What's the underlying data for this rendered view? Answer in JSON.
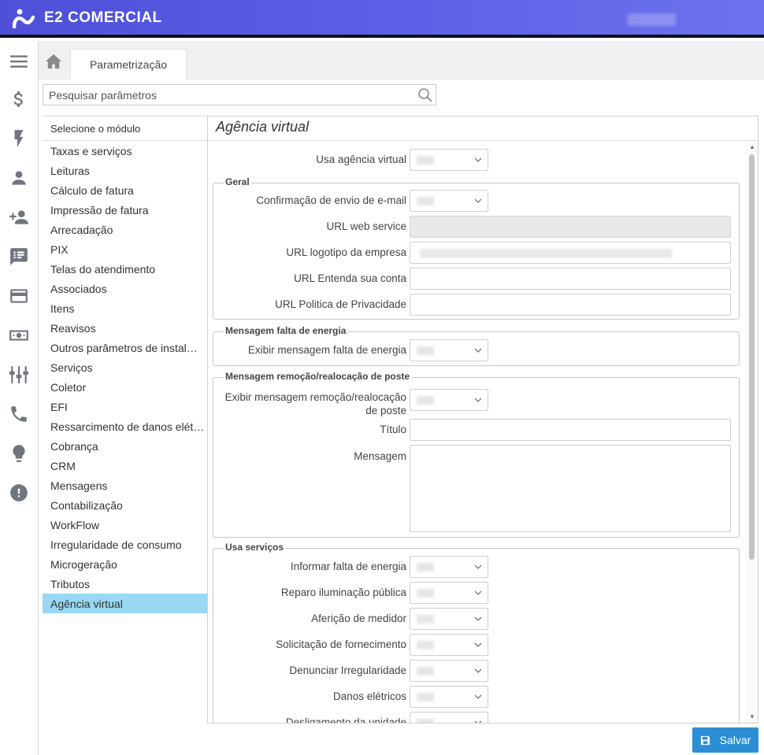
{
  "app": {
    "title": "E2 COMERCIAL"
  },
  "tabs": {
    "active": "Parametrização"
  },
  "search": {
    "placeholder": "Pesquisar parâmetros"
  },
  "modules": {
    "header": "Selecione o módulo",
    "items": [
      "Taxas e serviços",
      "Leituras",
      "Cálculo de fatura",
      "Impressão de fatura",
      "Arrecadação",
      "PIX",
      "Telas do atendimento",
      "Associados",
      "Itens",
      "Reavisos",
      "Outros parâmetros de instal…",
      "Serviços",
      "Coletor",
      "EFI",
      "Ressarcimento de danos elét…",
      "Cobrança",
      "CRM",
      "Mensagens",
      "Contabilização",
      "WorkFlow",
      "Irregularidade de consumo",
      "Microgeração",
      "Tributos",
      "Agência virtual"
    ],
    "active": "Agência virtual"
  },
  "panel": {
    "title": "Agência virtual",
    "usa_agencia": "Usa agência virtual",
    "geral": {
      "legend": "Geral",
      "confirmacao": "Confirmação de envio de e-mail",
      "url_ws": "URL web service",
      "url_logo": "URL logotipo da empresa",
      "url_entenda": "URL Entenda sua conta",
      "url_privacidade": "URL Politica de Privacidade"
    },
    "falta": {
      "legend": "Mensagem falta de energia",
      "exibir": "Exibir mensagem falta de energia"
    },
    "remocao": {
      "legend": "Mensagem remoção/realocação de poste",
      "exibir_l1": "Exibir mensagem remoção/realocação",
      "exibir_l2": "de poste",
      "titulo": "Título",
      "mensagem": "Mensagem"
    },
    "servicos": {
      "legend": "Usa serviços",
      "items": [
        "Informar falta de energia",
        "Reparo iluminação pública",
        "Aferição de medidor",
        "Solicitação de fornecimento",
        "Denunciar Irregularidade",
        "Danos elétricos",
        "Desligamento da unidade"
      ]
    }
  },
  "actions": {
    "save": "Salvar"
  },
  "colors": {
    "header_gradient_start": "#4f4fd8",
    "active_item": "#98d8f2",
    "save_button": "#2b8fd6"
  },
  "nav_icons": [
    "menu-icon",
    "dollar-icon",
    "lightning-icon",
    "person-icon",
    "add-person-icon",
    "feedback-icon",
    "credit-card-icon",
    "cash-icon",
    "equalizer-icon",
    "phone-icon",
    "lightbulb-icon",
    "alert-icon"
  ]
}
